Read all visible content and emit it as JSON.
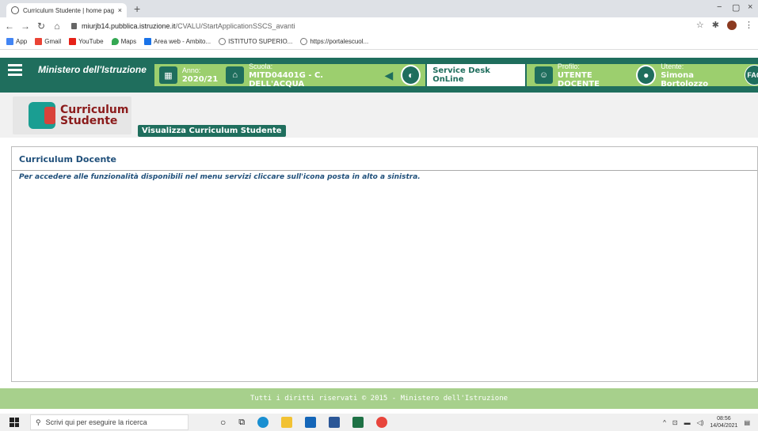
{
  "browser": {
    "tab_title": "Curriculum Studente | home pag",
    "tab_close": "×",
    "new_tab": "+",
    "window_controls": [
      "−",
      "▢",
      "×"
    ],
    "url_host": "miurjb14.pubblica.istruzione.it",
    "url_path": "/CVALU/StartApplicationSSCS_avanti",
    "bookmarks": [
      {
        "label": "App",
        "color": "#d33"
      },
      {
        "label": "Gmail",
        "color": "#ea4335"
      },
      {
        "label": "YouTube",
        "color": "#e62117"
      },
      {
        "label": "Maps",
        "color": "#34a853"
      },
      {
        "label": "Area web - Ambito...",
        "color": "#1a73e8"
      },
      {
        "label": "ISTITUTO SUPERIO...",
        "color": "#777"
      },
      {
        "label": "https://portalescuol...",
        "color": "#777"
      }
    ]
  },
  "header": {
    "ministry": "Ministero dell'Istruzione",
    "anno_label": "Anno:",
    "anno_value": "2020/21",
    "scuola_label": "Scuola:",
    "scuola_value": "MITD04401G - C. DELL'ACQUA",
    "service_desk": "Service Desk OnLine",
    "profilo_label": "Profilo:",
    "profilo_value": "UTENTE DOCENTE",
    "utente_label": "Utente:",
    "utente_value": "Simona Bortolozzo",
    "faq": "FAQ"
  },
  "logo": {
    "line1": "Curriculum",
    "line2": "Studente"
  },
  "view_button": "Visualizza Curriculum Studente",
  "panel": {
    "title": "Curriculum Docente",
    "message": "Per accedere alle funzionalità disponibili nel menu servizi cliccare sull'icona posta in alto a sinistra."
  },
  "footer": "Tutti i diritti riservati © 2015 - Ministero dell'Istruzione",
  "taskbar": {
    "search_placeholder": "Scrivi qui per eseguire la ricerca",
    "time": "08:56",
    "date": "14/04/2021"
  }
}
